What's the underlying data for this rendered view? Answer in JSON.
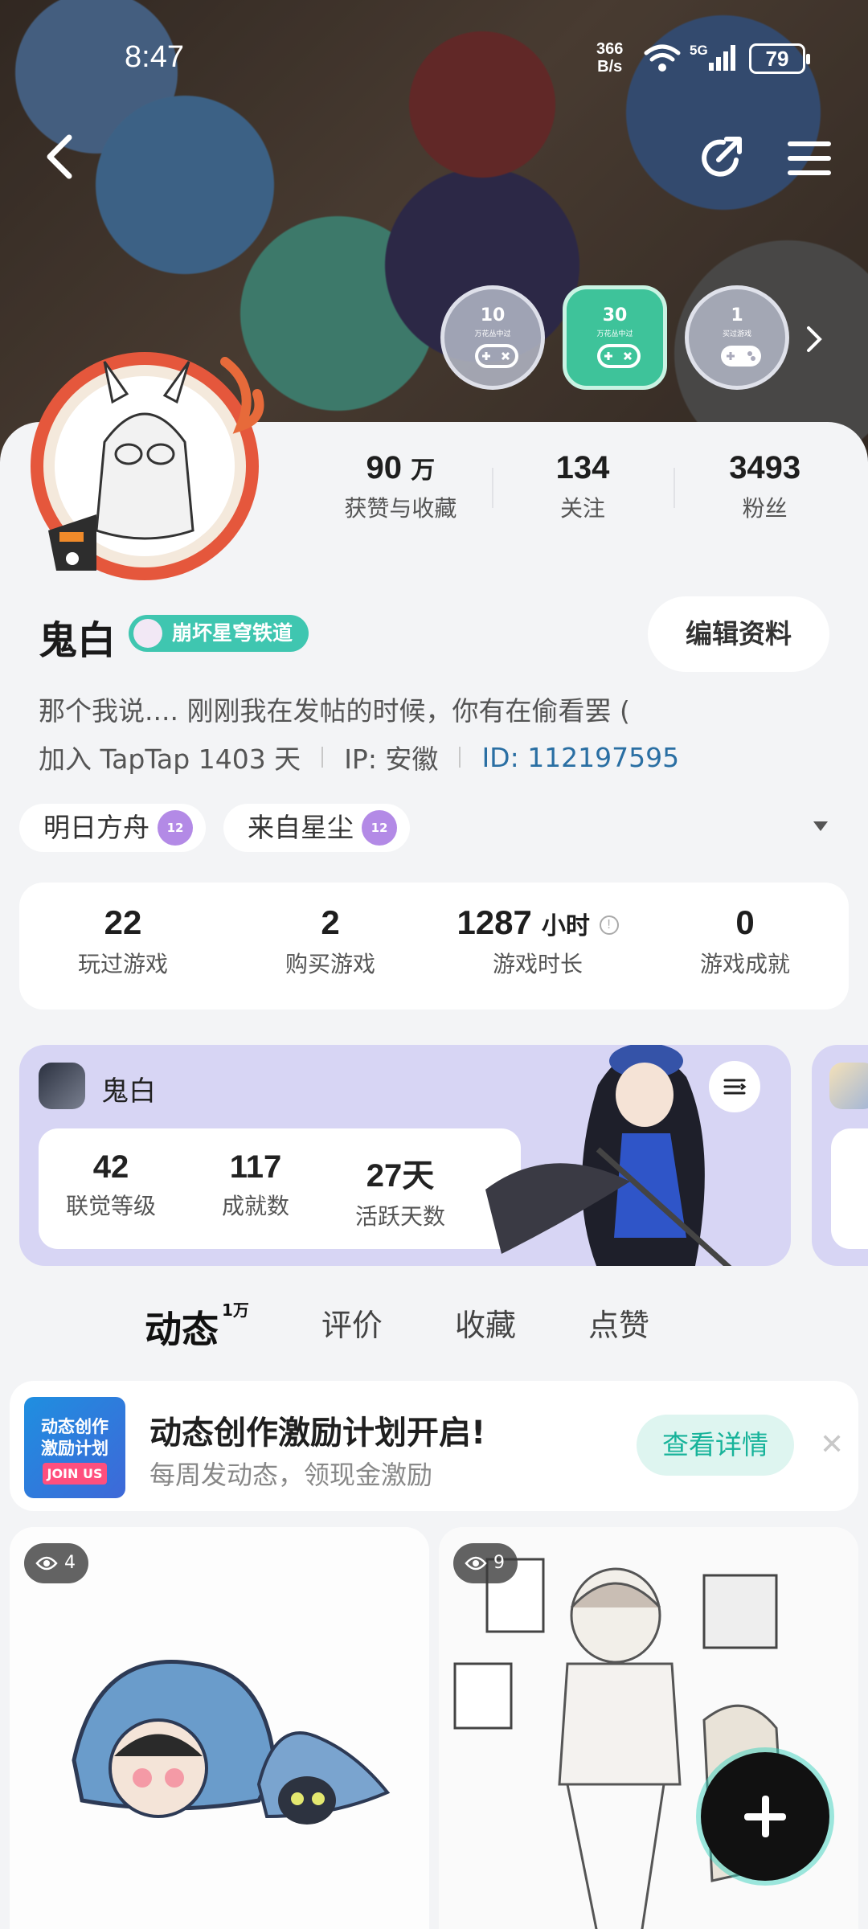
{
  "status_bar": {
    "time": "8:47",
    "net_speed_value": "366",
    "net_speed_unit": "B/s",
    "network": "5G",
    "battery": "79"
  },
  "nav": {
    "back_icon": "chevron-left-icon",
    "share_icon": "share-icon",
    "menu_icon": "menu-icon"
  },
  "badges": [
    {
      "num": "10",
      "caption": "万花丛中过"
    },
    {
      "num": "30",
      "caption": "万花丛中过"
    },
    {
      "num": "1",
      "caption": "买过游戏"
    }
  ],
  "profile_stats": [
    {
      "value": "90",
      "unit": "万",
      "label": "获赞与收藏"
    },
    {
      "value": "134",
      "unit": "",
      "label": "关注"
    },
    {
      "value": "3493",
      "unit": "",
      "label": "粉丝"
    }
  ],
  "user": {
    "name": "鬼白",
    "game_tag": "崩坏星穹铁道",
    "edit_button": "编辑资料",
    "bio": "那个我说.... 刚刚我在发帖的时候，你有在偷看罢 (",
    "joined": "加入 TapTap 1403 天",
    "ip": "IP:  安徽",
    "id": "ID:  112197595"
  },
  "game_tags": [
    {
      "name": "明日方舟",
      "level": "12"
    },
    {
      "name": "来自星尘",
      "level": "12"
    }
  ],
  "game_stats": [
    {
      "value": "22",
      "unit": "",
      "label": "玩过游戏"
    },
    {
      "value": "2",
      "unit": "",
      "label": "购买游戏"
    },
    {
      "value": "1287",
      "unit": "小时",
      "label": "游戏时长"
    },
    {
      "value": "0",
      "unit": "",
      "label": "游戏成就"
    }
  ],
  "game_card": {
    "player_name": "鬼白",
    "stats": [
      {
        "value": "42",
        "label": "联觉等级"
      },
      {
        "value": "117",
        "label": "成就数"
      },
      {
        "value": "27天",
        "label": "活跃天数"
      }
    ]
  },
  "tabs": [
    {
      "label": "动态",
      "count": "1万",
      "active": true
    },
    {
      "label": "评价"
    },
    {
      "label": "收藏"
    },
    {
      "label": "点赞"
    }
  ],
  "promo": {
    "image_line1": "动态创作",
    "image_line2": "激励计划",
    "image_line3": "JOIN US",
    "title": "动态创作激励计划开启!",
    "subtitle": "每周发动态，领现金激励",
    "button": "查看详情",
    "close": "✕"
  },
  "posts": [
    {
      "views": "4"
    },
    {
      "views": "9"
    }
  ],
  "colors": {
    "accent": "#3fc6b0",
    "link": "#2a6fa3",
    "card_bg": "#d7d5f4"
  }
}
